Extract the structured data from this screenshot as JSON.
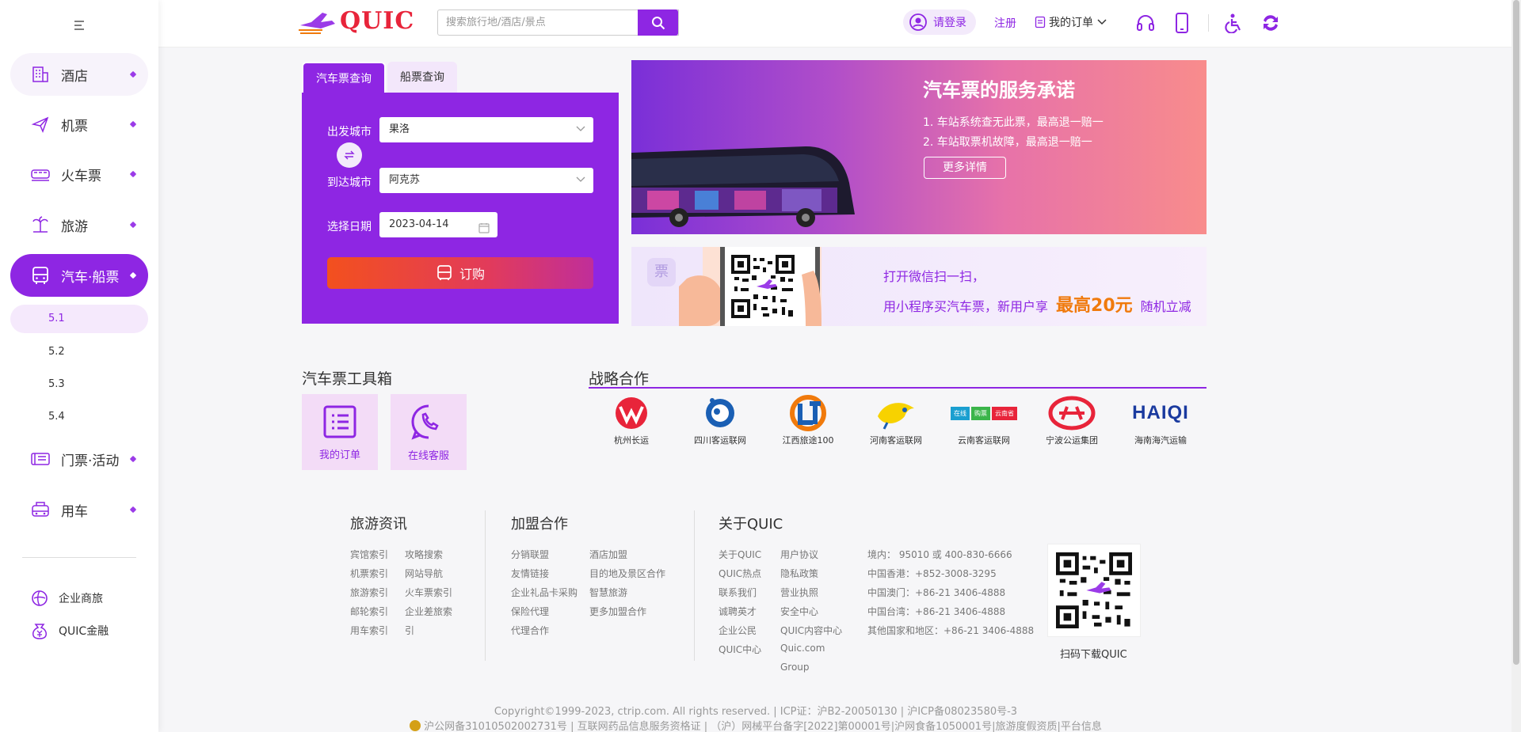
{
  "sidebar": {
    "items": [
      {
        "label": "酒店",
        "icon": "hotel-icon"
      },
      {
        "label": "机票",
        "icon": "plane-icon"
      },
      {
        "label": "火车票",
        "icon": "train-icon"
      },
      {
        "label": "旅游",
        "icon": "travel-icon"
      },
      {
        "label": "汽车·船票",
        "icon": "bus-icon"
      },
      {
        "label": "门票·活动",
        "icon": "ticket-icon"
      },
      {
        "label": "用车",
        "icon": "car-icon"
      }
    ],
    "sub_items": [
      "5.1",
      "5.2",
      "5.3",
      "5.4"
    ],
    "extra": [
      {
        "label": "企业商旅",
        "icon": "business-travel-icon"
      },
      {
        "label": "QUIC金融",
        "icon": "finance-icon"
      }
    ]
  },
  "header": {
    "logo_text": "QUIC",
    "search_placeholder": "搜索旅行地/酒店/景点",
    "login": "请登录",
    "register": "注册",
    "orders": "我的订单"
  },
  "booking": {
    "tabs": [
      "汽车票查询",
      "船票查询"
    ],
    "from_label": "出发城市",
    "from_value": "果洛",
    "to_label": "到达城市",
    "to_value": "阿克苏",
    "date_label": "选择日期",
    "date_value": "2023-04-14",
    "order_button": "订购"
  },
  "banner1": {
    "title": "汽车票的服务承诺",
    "line1": "1.  车站系统查无此票，最高退一赔一",
    "line2": "2.  车站取票机故障，最高退一赔一",
    "button": "更多详情"
  },
  "banner2": {
    "line1": "打开微信扫一扫，",
    "line2_a": "用小程序买汽车票，新用户享",
    "line2_big": "最高20元",
    "line2_b": "随机立减",
    "badge": "票"
  },
  "toolbox": {
    "title": "汽车票工具箱",
    "tools": [
      {
        "label": "我的订单",
        "icon": "order-list-icon"
      },
      {
        "label": "在线客服",
        "icon": "phone-icon"
      }
    ]
  },
  "partners": {
    "title": "战略合作",
    "items": [
      "杭州长运",
      "四川客运联网",
      "江西旅途100",
      "河南客运联网",
      "云南客运联网",
      "宁波公运集团",
      "海南海汽运输"
    ],
    "logo_texts": [
      "HAIQI",
      "在线",
      "购票",
      "云南省"
    ]
  },
  "footer": {
    "sections": [
      {
        "title": "旅游资讯",
        "col1": [
          "宾馆索引",
          "机票索引",
          "旅游索引",
          "邮轮索引",
          "用车索引"
        ],
        "col2": [
          "攻略搜索",
          "网站导航",
          "火车票索引",
          "企业差旅索",
          "引"
        ]
      },
      {
        "title": "加盟合作",
        "col1": [
          "分销联盟",
          "友情链接",
          "企业礼品卡采购",
          "保险代理",
          "代理合作"
        ],
        "col2": [
          "酒店加盟",
          "目的地及景区合作",
          "智慧旅游",
          "更多加盟合作"
        ]
      },
      {
        "title": "关于QUIC",
        "col1": [
          "关于QUIC",
          "QUIC热点",
          "联系我们",
          "诚聘英才",
          "企业公民",
          "QUIC中心"
        ],
        "col2": [
          "用户协议",
          "隐私政策",
          "营业执照",
          "安全中心",
          "QUIC内容中心",
          "Quic.com",
          "Group"
        ]
      }
    ],
    "contacts": [
      "境内：  95010 或 400-830-6666",
      "中国香港：+852-3008-3295",
      "中国澳门：+86-21 3406-4888",
      "中国台湾：+86-21 3406-4888",
      "其他国家和地区：+86-21 3406-4888"
    ],
    "qr_label": "扫码下载QUIC",
    "copyright": "Copyright©1999-2023, ctrip.com. All rights reserved. | ICP证：沪B2-20050130 | 沪ICP备08023580号-3",
    "license": "沪公网备31010502002731号 | 互联网药品信息服务资格证 | （沪）网械平台备字[2022]第00001号|沪网食备1050001号|旅游度假资质|平台信息"
  },
  "colors": {
    "brand": "#8e26e3",
    "accent": "#e8243a",
    "orange": "#f07a0c"
  }
}
